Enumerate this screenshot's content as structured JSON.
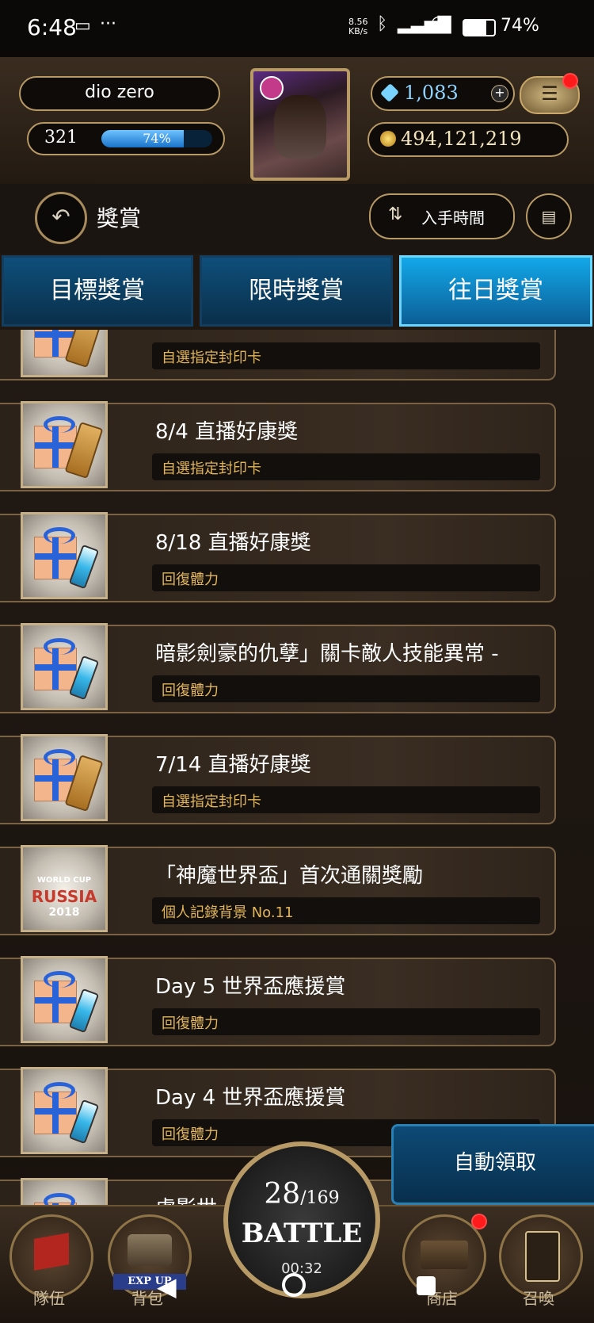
{
  "status_bar": {
    "time": "6:48",
    "speed": "8.56 KB/s",
    "battery": "74%"
  },
  "player": {
    "name": "dio zero",
    "level": "321",
    "xp_percent_label": "74%",
    "xp_fraction": 0.74
  },
  "currency": {
    "gems": "1,083",
    "gold": "494,121,219"
  },
  "page": {
    "title": "獎賞",
    "sort_label": "入手時間"
  },
  "tabs": [
    {
      "label": "目標獎賞",
      "active": false
    },
    {
      "label": "限時獎賞",
      "active": false
    },
    {
      "label": "往日獎賞",
      "active": true
    }
  ],
  "rewards": [
    {
      "title": "",
      "subtitle": "自選指定封印卡",
      "icon": "gift-scroll-icon"
    },
    {
      "title": "8/4 直播好康獎",
      "subtitle": "自選指定封印卡",
      "icon": "gift-scroll-icon"
    },
    {
      "title": "8/18 直播好康獎",
      "subtitle": "回復體力",
      "icon": "gift-potion-icon"
    },
    {
      "title": "暗影劍豪的仇孽」關卡敵人技能異常 -",
      "subtitle": "回復體力",
      "icon": "gift-potion-icon"
    },
    {
      "title": "7/14 直播好康獎",
      "subtitle": "自選指定封印卡",
      "icon": "gift-scroll-icon"
    },
    {
      "title": "「神魔世界盃」首次通關獎勵",
      "subtitle": "個人記錄背景 No.11",
      "icon": "world-cup-russia-icon"
    },
    {
      "title": "Day 5 世界盃應援賞",
      "subtitle": "回復體力",
      "icon": "gift-potion-icon"
    },
    {
      "title": "Day 4 世界盃應援賞",
      "subtitle": "回復體力",
      "icon": "gift-potion-icon"
    },
    {
      "title": "虛影世",
      "subtitle": "",
      "icon": "gift-potion-icon"
    }
  ],
  "russia_badge": {
    "line1": "WORLD CUP",
    "line2": "RUSSIA",
    "line3": "2018"
  },
  "auto_claim_label": "自動領取",
  "battle": {
    "current": "28",
    "total": "/169",
    "label": "BATTLE",
    "timer": "00:32"
  },
  "bottom_nav": [
    {
      "label": "隊伍",
      "icon": "flag-icon"
    },
    {
      "label": "背包",
      "icon": "chest-icon",
      "badge": "EXP UP"
    },
    {
      "label": "商店",
      "icon": "shop-icon"
    },
    {
      "label": "召喚",
      "icon": "card-icon"
    }
  ],
  "colors": {
    "tab_active": "#12a8ea",
    "subtitle_text": "#e2b658",
    "notification": "#ff1b1b"
  }
}
